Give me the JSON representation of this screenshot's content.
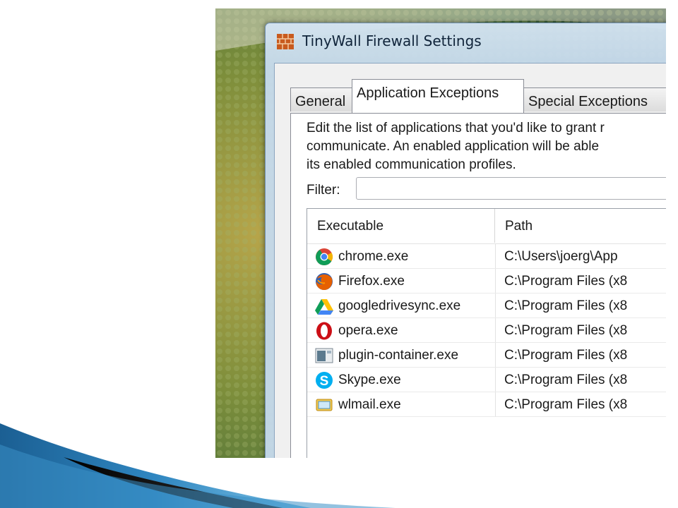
{
  "window": {
    "title": "TinyWall Firewall Settings"
  },
  "tabs": [
    {
      "label": "General",
      "active": false
    },
    {
      "label": "Application Exceptions",
      "active": true
    },
    {
      "label": "Special Exceptions",
      "active": false
    }
  ],
  "panel": {
    "description_lines": [
      "Edit the list of applications that you'd like to grant r",
      "communicate.  An enabled application will be able",
      "its enabled communication profiles."
    ],
    "filter_label": "Filter:",
    "filter_value": ""
  },
  "list": {
    "columns": [
      "Executable",
      "Path"
    ],
    "rows": [
      {
        "executable": "chrome.exe",
        "path": "C:\\Users\\joerg\\App",
        "icon": "chrome-icon"
      },
      {
        "executable": "Firefox.exe",
        "path": "C:\\Program Files (x8",
        "icon": "firefox-icon"
      },
      {
        "executable": "googledrivesync.exe",
        "path": "C:\\Program Files (x8",
        "icon": "google-drive-icon"
      },
      {
        "executable": "opera.exe",
        "path": "C:\\Program Files (x8",
        "icon": "opera-icon"
      },
      {
        "executable": "plugin-container.exe",
        "path": "C:\\Program Files (x8",
        "icon": "plugin-container-icon"
      },
      {
        "executable": "Skype.exe",
        "path": "C:\\Program Files (x8",
        "icon": "skype-icon"
      },
      {
        "executable": "wlmail.exe",
        "path": "C:\\Program Files (x8",
        "icon": "windows-live-mail-icon"
      }
    ]
  },
  "colors": {
    "titlebar": "#cfe0f0",
    "slide_accent": "#1f6aa0"
  }
}
